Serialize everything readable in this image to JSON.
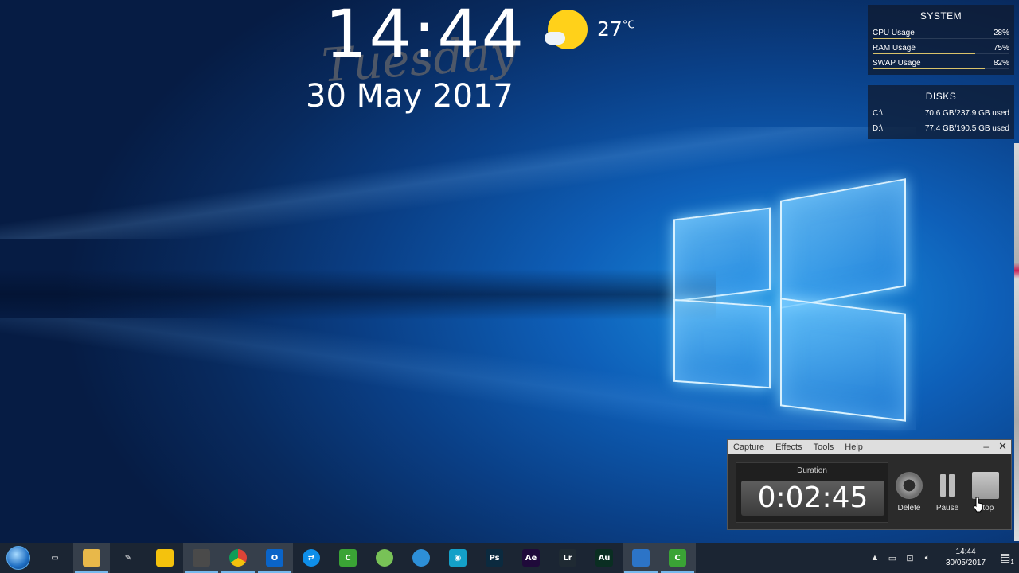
{
  "desktop": {
    "clock": {
      "time": "14:44",
      "day": "Tuesday",
      "date": "30 May 2017"
    },
    "weather": {
      "temperature": "27",
      "unit": "°C",
      "icon": "sun-cloud-icon"
    }
  },
  "system_panel": {
    "title": "SYSTEM",
    "rows": [
      {
        "label": "CPU Usage",
        "value": "28%",
        "level": 0.28
      },
      {
        "label": "RAM Usage",
        "value": "75%",
        "level": 0.75
      },
      {
        "label": "SWAP Usage",
        "value": "82%",
        "level": 0.82
      }
    ]
  },
  "disks_panel": {
    "title": "DISKS",
    "rows": [
      {
        "label": "C:\\",
        "value": "70.6 GB/237.9 GB used",
        "level": 0.3
      },
      {
        "label": "D:\\",
        "value": "77.4 GB/190.5 GB used",
        "level": 0.41
      }
    ]
  },
  "recorder": {
    "menu": [
      "Capture",
      "Effects",
      "Tools",
      "Help"
    ],
    "minimize": "–",
    "close": "✕",
    "duration_label": "Duration",
    "duration_value": "0:02:45",
    "buttons": {
      "delete": "Delete",
      "pause": "Pause",
      "stop": "Stop"
    }
  },
  "taskbar": {
    "apps": [
      {
        "name": "task-view",
        "glyph": "▭",
        "color": "transparent"
      },
      {
        "name": "file-explorer",
        "glyph": "",
        "color": "#e8b84a"
      },
      {
        "name": "paint-app",
        "glyph": "✎",
        "color": "transparent"
      },
      {
        "name": "keep-notes",
        "glyph": "",
        "color": "#f4c20d"
      },
      {
        "name": "sublime-text",
        "glyph": "",
        "color": "#4a4a4a"
      },
      {
        "name": "chrome",
        "glyph": "",
        "color": "#db4437"
      },
      {
        "name": "outlook",
        "glyph": "O",
        "color": "#0a64c8"
      },
      {
        "name": "teamviewer",
        "glyph": "⇄",
        "color": "#0e8ee9"
      },
      {
        "name": "camtasia",
        "glyph": "C",
        "color": "#3aa335"
      },
      {
        "name": "android-studio",
        "glyph": "",
        "color": "#78c257"
      },
      {
        "name": "settings-app",
        "glyph": "",
        "color": "#2d8fd8"
      },
      {
        "name": "eye-app",
        "glyph": "◉",
        "color": "#14a0c8"
      },
      {
        "name": "photoshop",
        "glyph": "Ps",
        "color": "#0b2a3f"
      },
      {
        "name": "after-effects",
        "glyph": "Ae",
        "color": "#1f0a3a"
      },
      {
        "name": "lightroom",
        "glyph": "Lr",
        "color": "#1f2a33"
      },
      {
        "name": "audition",
        "glyph": "Au",
        "color": "#0a2e22"
      },
      {
        "name": "media-app",
        "glyph": "",
        "color": "#2c74c7"
      },
      {
        "name": "camtasia-recorder",
        "glyph": "C",
        "color": "#3aa335"
      }
    ],
    "tray": {
      "chevron": "▲",
      "time": "14:44",
      "date": "30/05/2017",
      "notifications": "1"
    }
  },
  "colors": {
    "accent": "#76b9ed",
    "meter": "#d8c26a"
  }
}
